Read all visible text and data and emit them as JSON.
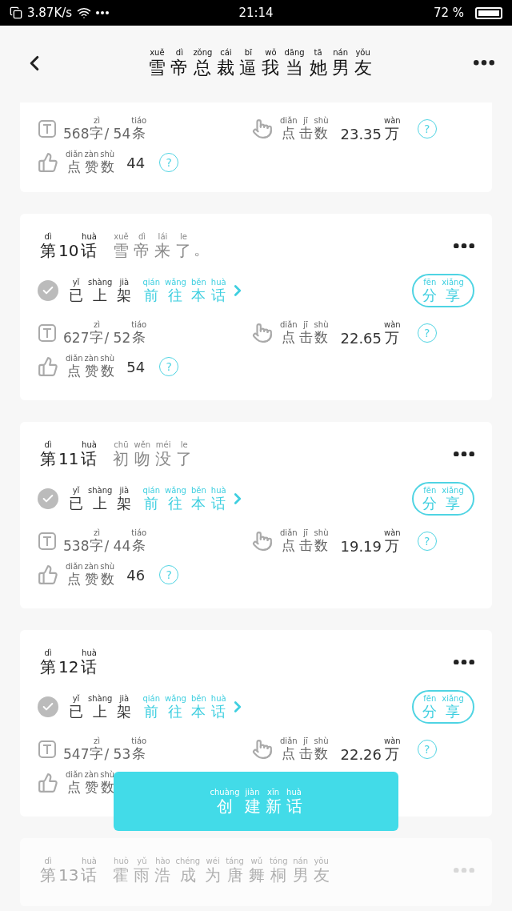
{
  "status_bar": {
    "speed": "3.87K/s",
    "time": "21:14",
    "battery": "72 %"
  },
  "header": {
    "title": [
      [
        "xuě",
        "雪"
      ],
      [
        "dì",
        "帝"
      ],
      [
        "zǒng",
        "总"
      ],
      [
        "cái",
        "裁"
      ],
      [
        "bī",
        "逼"
      ],
      [
        "wǒ",
        "我"
      ],
      [
        "dāng",
        "当"
      ],
      [
        "tā",
        "她"
      ],
      [
        "nán",
        "男"
      ],
      [
        "yǒu",
        "友"
      ]
    ]
  },
  "chapters": [
    {
      "partial": true,
      "faded": false,
      "words": [
        "568",
        [
          "zì",
          "字"
        ],
        "/ 54",
        [
          "tiáo",
          "条"
        ]
      ],
      "clicks_label": [
        [
          "diǎn",
          "点"
        ],
        [
          "jī",
          "击"
        ],
        [
          "shù",
          "数"
        ]
      ],
      "clicks": [
        "23.35",
        [
          "wàn",
          "万"
        ]
      ],
      "clicks_help": "?",
      "likes_label": [
        [
          "diǎn",
          "点"
        ],
        [
          "zàn",
          "赞"
        ],
        [
          "shù",
          "数"
        ]
      ],
      "likes": "44",
      "likes_help": "?"
    },
    {
      "partial": false,
      "faded": false,
      "title": [
        [
          "dì",
          "第"
        ],
        "10",
        [
          "huà",
          "话"
        ]
      ],
      "subtitle": [
        [
          "xuě",
          "雪"
        ],
        [
          "dì",
          "帝"
        ],
        [
          "lái",
          "来"
        ],
        [
          "le",
          "了"
        ],
        "。"
      ],
      "status": [
        [
          "yǐ",
          "已"
        ],
        [
          "shàng",
          "上"
        ],
        [
          "jià",
          "架"
        ]
      ],
      "link": [
        [
          "qián",
          "前"
        ],
        [
          "wǎng",
          "往"
        ],
        [
          "běn",
          "本"
        ],
        [
          "huà",
          "话"
        ]
      ],
      "share": [
        [
          "fēn",
          "分"
        ],
        [
          "xiǎng",
          "享"
        ]
      ],
      "words": [
        "627",
        [
          "zì",
          "字"
        ],
        "/ 52",
        [
          "tiáo",
          "条"
        ]
      ],
      "clicks_label": [
        [
          "diǎn",
          "点"
        ],
        [
          "jī",
          "击"
        ],
        [
          "shù",
          "数"
        ]
      ],
      "clicks": [
        "22.65",
        [
          "wàn",
          "万"
        ]
      ],
      "clicks_help": "?",
      "likes_label": [
        [
          "diǎn",
          "点"
        ],
        [
          "zàn",
          "赞"
        ],
        [
          "shù",
          "数"
        ]
      ],
      "likes": "54",
      "likes_help": "?"
    },
    {
      "partial": false,
      "faded": false,
      "title": [
        [
          "dì",
          "第"
        ],
        "11",
        [
          "huà",
          "话"
        ]
      ],
      "subtitle": [
        [
          "chū",
          "初"
        ],
        [
          "wěn",
          "吻"
        ],
        [
          "méi",
          "没"
        ],
        [
          "le",
          "了"
        ]
      ],
      "status": [
        [
          "yǐ",
          "已"
        ],
        [
          "shàng",
          "上"
        ],
        [
          "jià",
          "架"
        ]
      ],
      "link": [
        [
          "qián",
          "前"
        ],
        [
          "wǎng",
          "往"
        ],
        [
          "běn",
          "本"
        ],
        [
          "huà",
          "话"
        ]
      ],
      "share": [
        [
          "fēn",
          "分"
        ],
        [
          "xiǎng",
          "享"
        ]
      ],
      "words": [
        "538",
        [
          "zì",
          "字"
        ],
        "/ 44",
        [
          "tiáo",
          "条"
        ]
      ],
      "clicks_label": [
        [
          "diǎn",
          "点"
        ],
        [
          "jī",
          "击"
        ],
        [
          "shù",
          "数"
        ]
      ],
      "clicks": [
        "19.19",
        [
          "wàn",
          "万"
        ]
      ],
      "clicks_help": "?",
      "likes_label": [
        [
          "diǎn",
          "点"
        ],
        [
          "zàn",
          "赞"
        ],
        [
          "shù",
          "数"
        ]
      ],
      "likes": "46",
      "likes_help": "?"
    },
    {
      "partial": false,
      "faded": false,
      "title": [
        [
          "dì",
          "第"
        ],
        "12",
        [
          "huà",
          "话"
        ]
      ],
      "status": [
        [
          "yǐ",
          "已"
        ],
        [
          "shàng",
          "上"
        ],
        [
          "jià",
          "架"
        ]
      ],
      "link": [
        [
          "qián",
          "前"
        ],
        [
          "wǎng",
          "往"
        ],
        [
          "běn",
          "本"
        ],
        [
          "huà",
          "话"
        ]
      ],
      "share": [
        [
          "fēn",
          "分"
        ],
        [
          "xiǎng",
          "享"
        ]
      ],
      "words": [
        "547",
        [
          "zì",
          "字"
        ],
        "/ 53",
        [
          "tiáo",
          "条"
        ]
      ],
      "clicks_label": [
        [
          "diǎn",
          "点"
        ],
        [
          "jī",
          "击"
        ],
        [
          "shù",
          "数"
        ]
      ],
      "clicks": [
        "22.26",
        [
          "wàn",
          "万"
        ]
      ],
      "clicks_help": "?",
      "likes_label": [
        [
          "diǎn",
          "点"
        ],
        [
          "zàn",
          "赞"
        ],
        [
          "shù",
          "数"
        ]
      ]
    },
    {
      "partial": false,
      "faded": true,
      "title": [
        [
          "dì",
          "第"
        ],
        "13",
        [
          "huà",
          "话"
        ]
      ],
      "subtitle": [
        [
          "huò",
          "霍"
        ],
        [
          "yǔ",
          "雨"
        ],
        [
          "hào",
          "浩"
        ],
        [
          "chéng",
          "成"
        ],
        [
          "wéi",
          "为"
        ],
        [
          "táng",
          "唐"
        ],
        [
          "wǔ",
          "舞"
        ],
        [
          "tóng",
          "桐"
        ],
        [
          "nán",
          "男"
        ],
        [
          "yǒu",
          "友"
        ]
      ]
    }
  ],
  "create_button": [
    [
      "chuàng",
      "创"
    ],
    [
      "jiàn",
      "建"
    ],
    [
      "xīn",
      "新"
    ],
    [
      "huà",
      "话"
    ]
  ]
}
